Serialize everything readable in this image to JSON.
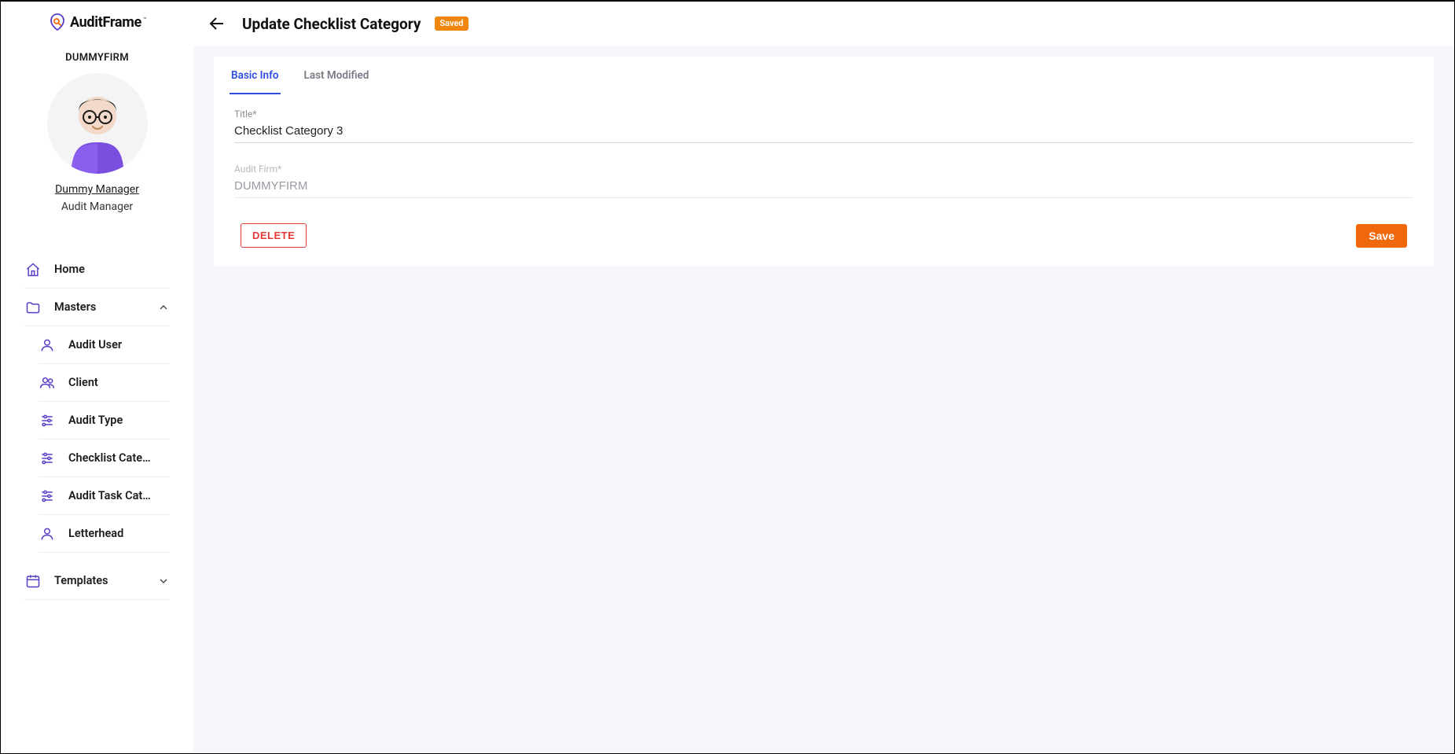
{
  "brand": {
    "name": "AuditFrame",
    "tm": "™"
  },
  "firm": {
    "name": "DUMMYFIRM"
  },
  "user": {
    "name": "Dummy Manager",
    "role": "Audit Manager"
  },
  "nav": {
    "home": "Home",
    "masters": "Masters",
    "templates": "Templates",
    "sub": {
      "audit_user": "Audit User",
      "client": "Client",
      "audit_type": "Audit Type",
      "checklist_category": "Checklist Cate…",
      "audit_task_category": "Audit Task Cat…",
      "letterhead": "Letterhead"
    }
  },
  "header": {
    "title": "Update Checklist Category",
    "badge": "Saved"
  },
  "tabs": {
    "basic_info": "Basic Info",
    "last_modified": "Last Modified"
  },
  "form": {
    "title_label": "Title*",
    "title_value": "Checklist Category 3",
    "firm_label": "Audit Firm*",
    "firm_value": "DUMMYFIRM"
  },
  "actions": {
    "delete": "DELETE",
    "save": "Save"
  }
}
